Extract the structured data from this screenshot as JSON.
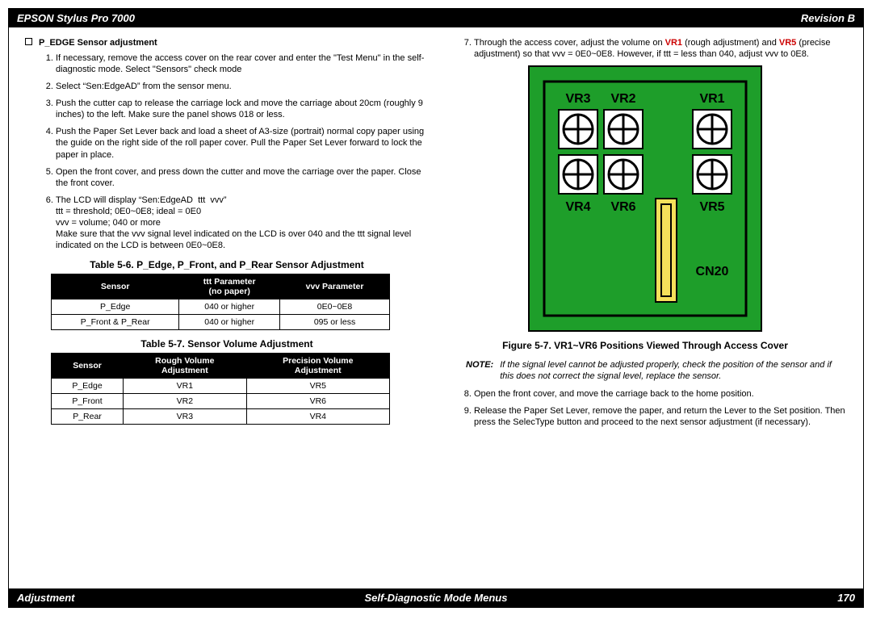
{
  "header": {
    "left": "EPSON Stylus Pro 7000",
    "right": "Revision B"
  },
  "footer": {
    "left": "Adjustment",
    "center": "Self-Diagnostic Mode Menus",
    "right": "170"
  },
  "section_title": "P_EDGE Sensor adjustment",
  "steps_left": [
    "If necessary, remove the access cover on the rear cover and enter the \"Test Menu\" in the self-diagnostic mode. Select \"Sensors\" check mode",
    "Select “Sen:EdgeAD” from the sensor menu.",
    "Push the cutter cap to release the carriage lock and move the carriage about 20cm (roughly 9 inches) to the left. Make sure the panel shows 018 or less.",
    "Push the Paper Set Lever back and load a sheet of A3-size (portrait) normal copy paper using the guide on the right side of the roll paper cover. Pull the Paper Set Lever forward to lock the paper in place.",
    "Open the front cover, and press down the cutter and move the carriage over the paper. Close the front cover."
  ],
  "step6_main": "The LCD will display “Sen:EdgeAD  ttt  vvv”",
  "step6_sub1": "ttt = threshold; 0E0~0E8; ideal = 0E0",
  "step6_sub2": "vvv = volume; 040 or more",
  "step6_sub3": "Make sure that the vvv signal level indicated on the LCD is over 040 and the ttt signal level indicated on the LCD is between 0E0~0E8.",
  "table56_caption": "Table 5-6.  P_Edge, P_Front, and P_Rear Sensor Adjustment",
  "table56_headers": [
    "Sensor",
    "ttt Parameter\n(no paper)",
    "vvv Parameter"
  ],
  "table56_rows": [
    [
      "P_Edge",
      "040 or higher",
      "0E0~0E8"
    ],
    [
      "P_Front & P_Rear",
      "040 or higher",
      "095 or less"
    ]
  ],
  "table57_caption": "Table 5-7.  Sensor Volume Adjustment",
  "table57_headers": [
    "Sensor",
    "Rough Volume\nAdjustment",
    "Precision Volume\nAdjustment"
  ],
  "table57_rows": [
    [
      "P_Edge",
      "VR1",
      "VR5"
    ],
    [
      "P_Front",
      "VR2",
      "VR6"
    ],
    [
      "P_Rear",
      "VR3",
      "VR4"
    ]
  ],
  "step7_pre": "Through the access cover, adjust the volume on ",
  "step7_vr1": "VR1",
  "step7_mid1": " (rough adjustment) and ",
  "step7_vr5": "VR5",
  "step7_post": " (precise adjustment) so that vvv = 0E0~0E8. However, if ttt = less than 040, adjust vvv to 0E8.",
  "figure_caption": "Figure 5-7.  VR1~VR6 Positions Viewed Through Access Cover",
  "note_label": "NOTE:",
  "note_text": "If the signal level cannot be adjusted properly, check the position of the sensor and if this does not correct the signal level, replace the sensor.",
  "steps_right": [
    "Open the front cover, and move the carriage back to the home position.",
    "Release the Paper Set Lever, remove the paper, and return the Lever to the Set position. Then press the SelecType button and proceed to the next sensor adjustment (if necessary)."
  ],
  "board": {
    "labels": [
      "VR3",
      "VR2",
      "VR1",
      "VR4",
      "VR6",
      "VR5",
      "CN20"
    ]
  },
  "chart_data": [
    {
      "type": "table",
      "title": "Table 5-6. P_Edge, P_Front, and P_Rear Sensor Adjustment",
      "columns": [
        "Sensor",
        "ttt Parameter (no paper)",
        "vvv Parameter"
      ],
      "rows": [
        [
          "P_Edge",
          "040 or higher",
          "0E0~0E8"
        ],
        [
          "P_Front & P_Rear",
          "040 or higher",
          "095 or less"
        ]
      ]
    },
    {
      "type": "table",
      "title": "Table 5-7. Sensor Volume Adjustment",
      "columns": [
        "Sensor",
        "Rough Volume Adjustment",
        "Precision Volume Adjustment"
      ],
      "rows": [
        [
          "P_Edge",
          "VR1",
          "VR5"
        ],
        [
          "P_Front",
          "VR2",
          "VR6"
        ],
        [
          "P_Rear",
          "VR3",
          "VR4"
        ]
      ]
    }
  ]
}
